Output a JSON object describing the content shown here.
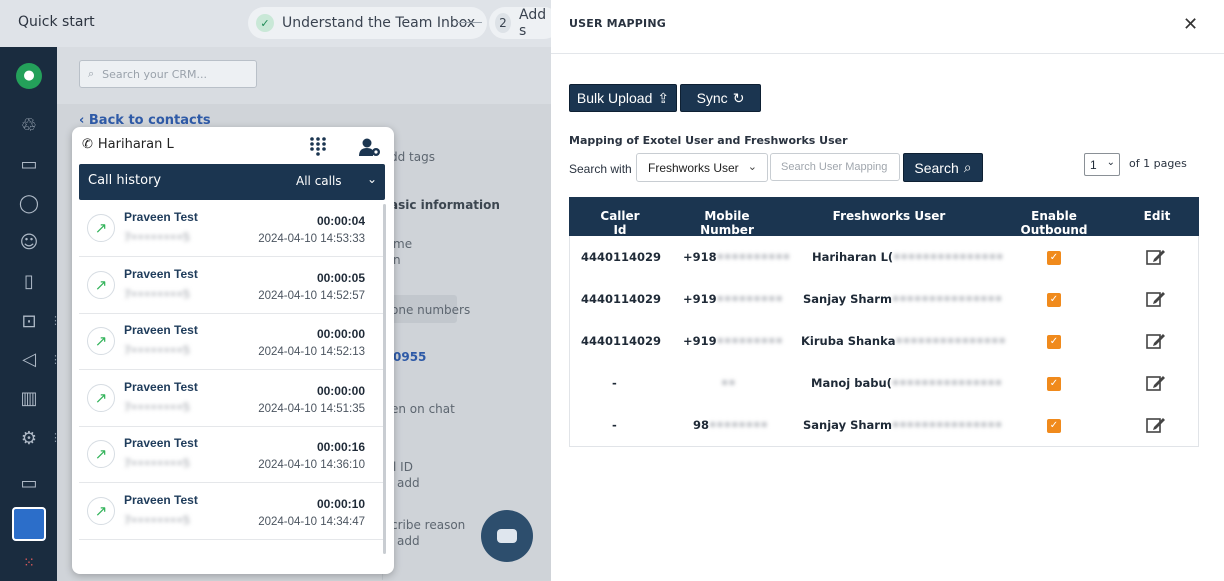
{
  "quickstart": {
    "title": "Quick start",
    "step1_label": "Understand the Team Inbox",
    "step2_number": "2",
    "step2_label": "Add s"
  },
  "crm": {
    "search_placeholder": "Search your CRM...",
    "back_link": "Back to contacts",
    "snippets": [
      "dd tags",
      "asic information",
      "me",
      "n",
      "one numbers",
      "0955",
      "en on chat",
      "l ID",
      "add",
      "cribe reason",
      "add"
    ]
  },
  "dialer": {
    "agent_name": "Hariharan L",
    "history_label": "Call history",
    "filter_value": "All calls",
    "calls": [
      {
        "name": "Praveen Test",
        "number": "7••••••••5",
        "duration": "00:00:04",
        "time": "2024-04-10 14:53:33"
      },
      {
        "name": "Praveen Test",
        "number": "7••••••••5",
        "duration": "00:00:05",
        "time": "2024-04-10 14:52:57"
      },
      {
        "name": "Praveen Test",
        "number": "7••••••••5",
        "duration": "00:00:00",
        "time": "2024-04-10 14:52:13"
      },
      {
        "name": "Praveen Test",
        "number": "7••••••••5",
        "duration": "00:00:00",
        "time": "2024-04-10 14:51:35"
      },
      {
        "name": "Praveen Test",
        "number": "7••••••••5",
        "duration": "00:00:16",
        "time": "2024-04-10 14:36:10"
      },
      {
        "name": "Praveen Test",
        "number": "7••••••••5",
        "duration": "00:00:10",
        "time": "2024-04-10 14:34:47"
      }
    ]
  },
  "panel": {
    "title": "USER MAPPING",
    "close_symbol": "✕",
    "bulk_upload_label": "Bulk Upload",
    "sync_label": "Sync",
    "mapping_label": "Mapping of Exotel User and Freshworks User",
    "search_with_label": "Search with",
    "search_with_value": "Freshworks User",
    "search_placeholder": "Search User Mapping",
    "search_button": "Search",
    "page_value": "1",
    "of_pages": "of 1 pages",
    "columns": [
      "Caller Id",
      "Mobile Number",
      "Freshworks User",
      "Enable Outbound",
      "Edit"
    ],
    "rows": [
      {
        "caller_id": "4440114029",
        "mobile_visible": "+918",
        "mobile_hidden": "••••••••••",
        "user_visible": "Hariharan L(",
        "user_hidden": "•••••••••••••••",
        "outbound": true
      },
      {
        "caller_id": "4440114029",
        "mobile_visible": "+919",
        "mobile_hidden": "•••••••••",
        "user_visible": "Sanjay Sharm",
        "user_hidden": "•••••••••••••••",
        "outbound": true
      },
      {
        "caller_id": "4440114029",
        "mobile_visible": "+919",
        "mobile_hidden": "•••••••••",
        "user_visible": "Kiruba Shanka",
        "user_hidden": "•••••••••••••••",
        "outbound": true
      },
      {
        "caller_id": "-",
        "mobile_visible": "",
        "mobile_hidden": "••",
        "user_visible": "Manoj babu(",
        "user_hidden": "•••••••••••••••",
        "outbound": true
      },
      {
        "caller_id": "-",
        "mobile_visible": "98",
        "mobile_hidden": "••••••••",
        "user_visible": "Sanjay Sharm",
        "user_hidden": "•••••••••••••••",
        "outbound": true
      }
    ]
  },
  "colors": {
    "navy": "#1b3550",
    "sidebar": "#1a2c3f",
    "checkbox": "#f08a1c",
    "call_arrow": "#34b45b"
  }
}
